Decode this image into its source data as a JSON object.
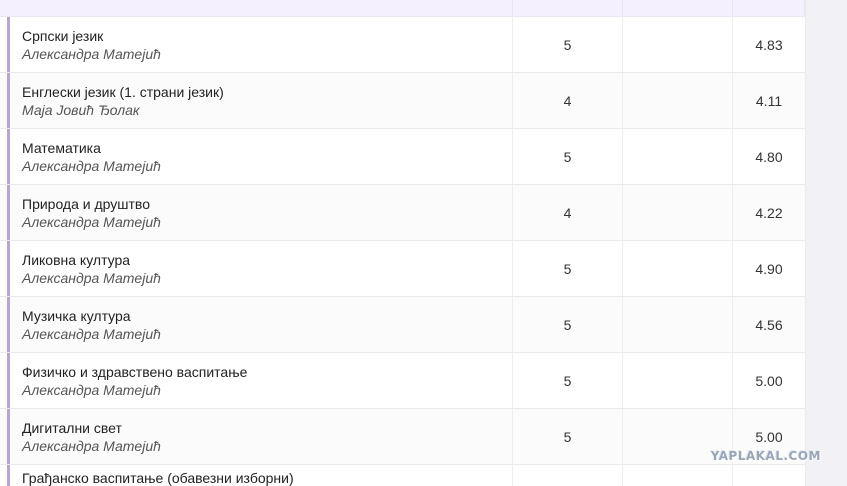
{
  "rows": [
    {
      "subject": "Српски језик",
      "teacher": "Александра Матејић",
      "grade": "5",
      "avg": "4.83"
    },
    {
      "subject": "Енглески језик (1. страни језик)",
      "teacher": "Маја Јовић Ђолак",
      "grade": "4",
      "avg": "4.11"
    },
    {
      "subject": "Математика",
      "teacher": "Александра Матејић",
      "grade": "5",
      "avg": "4.80"
    },
    {
      "subject": "Природа и друштво",
      "teacher": "Александра Матејић",
      "grade": "4",
      "avg": "4.22"
    },
    {
      "subject": "Ликовна култура",
      "teacher": "Александра Матејић",
      "grade": "5",
      "avg": "4.90"
    },
    {
      "subject": "Музичка култура",
      "teacher": "Александра Матејић",
      "grade": "5",
      "avg": "4.56"
    },
    {
      "subject": "Физичко и здравствено васпитање",
      "teacher": "Александра Матејић",
      "grade": "5",
      "avg": "5.00"
    },
    {
      "subject": "Дигитални свет",
      "teacher": "Александра Матејић",
      "grade": "5",
      "avg": "5.00"
    }
  ],
  "partial_row": {
    "subject": "Грађанско васпитање (обавезни изборни)"
  },
  "watermark": "YAPLAKAL.COM",
  "colors": {
    "accent": "#b6a4dc",
    "header_bg": "#f5f0fd"
  }
}
